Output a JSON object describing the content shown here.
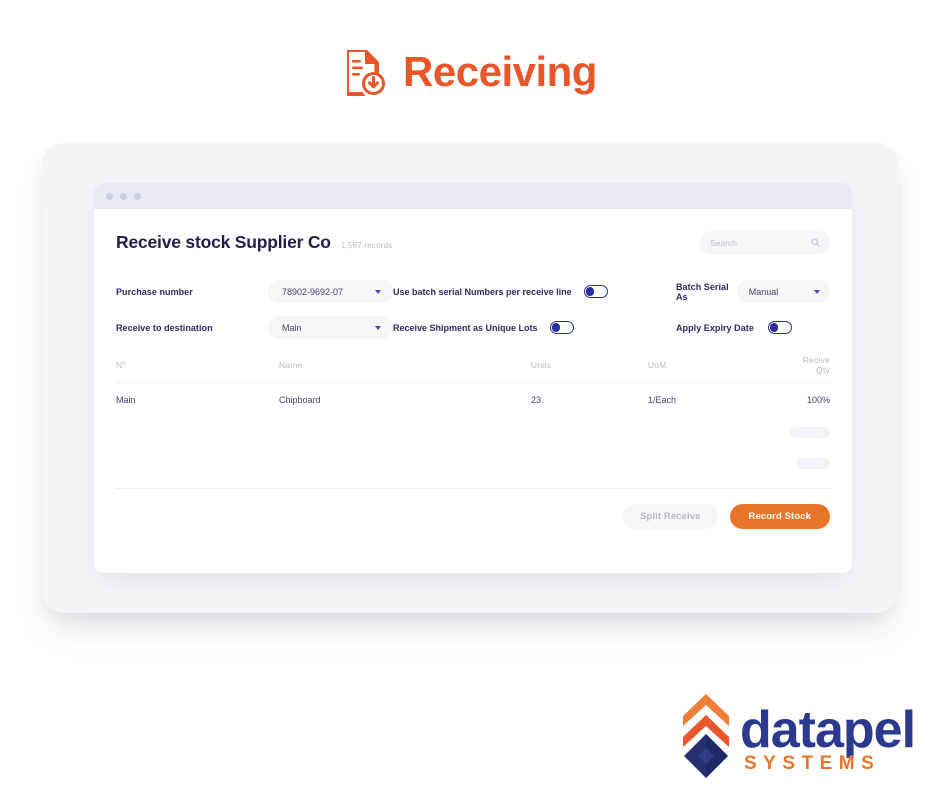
{
  "page": {
    "title": "Receiving",
    "title_icon": "document-download-icon",
    "accent_orange": "#e8562a",
    "navy": "#2d2a63"
  },
  "window": {
    "dots": [
      "window-dot-1",
      "window-dot-2",
      "window-dot-3"
    ]
  },
  "app": {
    "title": "Receive stock Supplier Co",
    "records": "1,567 records",
    "search": {
      "placeholder": "Search",
      "icon": "search-icon"
    }
  },
  "form": {
    "purchase_number": {
      "label": "Purchase number",
      "value": "78902-9692-07"
    },
    "receive_destination": {
      "label": "Receive to destination",
      "value": "Main"
    },
    "batch_serial_per_line": {
      "label": "Use batch serial Numbers per receive line",
      "state": "on"
    },
    "unique_lots": {
      "label": "Receive Shipment as Unique Lots",
      "state": "on"
    },
    "batch_serial_as": {
      "label": "Batch Serial As",
      "value": "Manual"
    },
    "apply_expiry_date": {
      "label": "Apply Expiry Date",
      "state": "on"
    }
  },
  "table": {
    "columns": [
      "Nº",
      "Name",
      "Units",
      "UoM",
      "Recive Qty"
    ],
    "rows": [
      {
        "no": "Main",
        "name": "Chipboard",
        "units": "23",
        "uom": "1/Each",
        "qty": "100%"
      }
    ],
    "loading_rows": 2
  },
  "footer": {
    "split_receive": "Split Receive",
    "record_stock": "Record Stock"
  },
  "brand": {
    "name": "datapel",
    "tagline": "SYSTEMS",
    "navy": "#2b3a8f",
    "orange": "#e8762a"
  }
}
